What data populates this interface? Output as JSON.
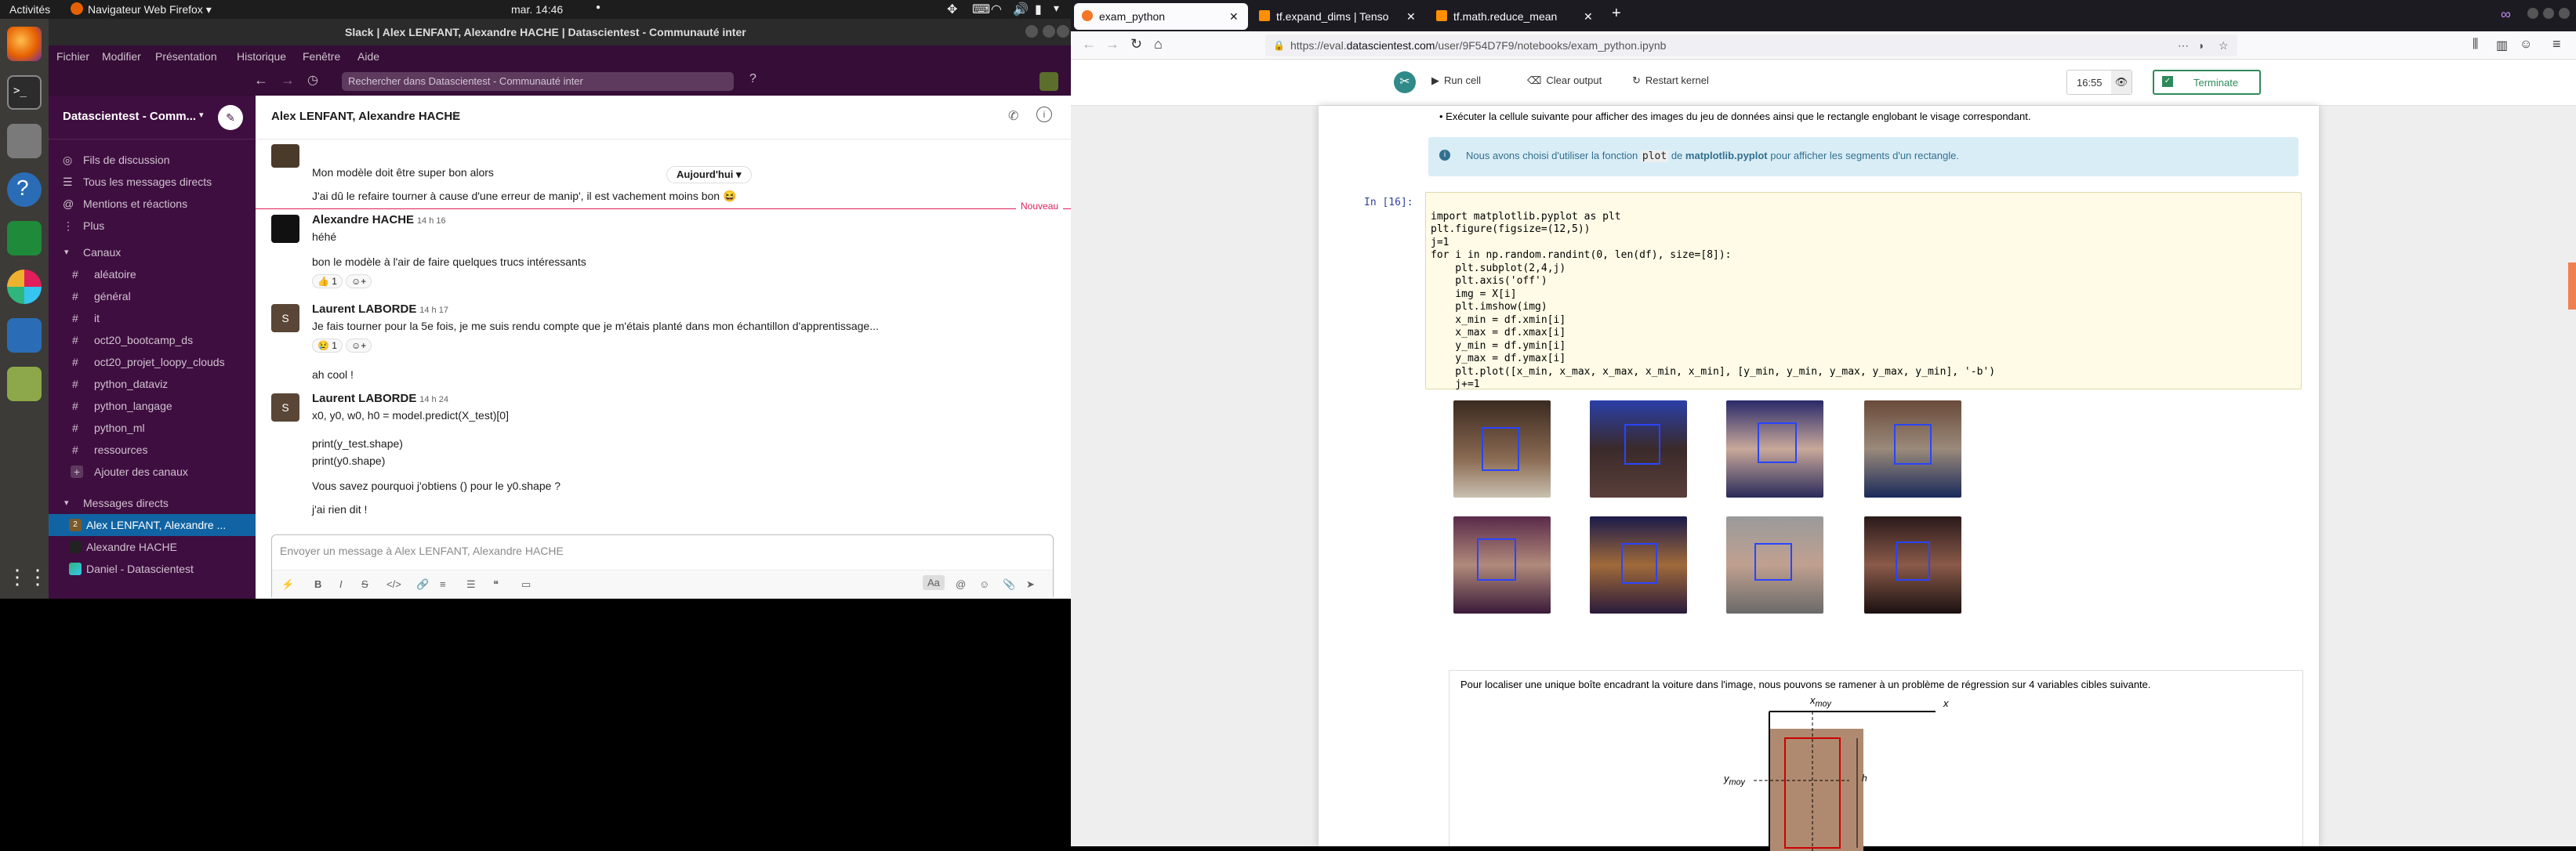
{
  "topbar": {
    "activities": "Activités",
    "app": "Navigateur Web Firefox",
    "clock": "mar. 14:46"
  },
  "slack": {
    "window_title": "Slack | Alex LENFANT, Alexandre HACHE | Datascientest - Communauté inter",
    "menu": [
      "Fichier",
      "Modifier",
      "Présentation",
      "Historique",
      "Fenêtre",
      "Aide"
    ],
    "search_placeholder": "Rechercher dans Datascientest - Communauté inter",
    "workspace": "Datascientest - Comm...",
    "nav": [
      "Fils de discussion",
      "Tous les messages directs",
      "Mentions et réactions",
      "Plus"
    ],
    "channels_header": "Canaux",
    "channels": [
      "aléatoire",
      "général",
      "it",
      "oct20_bootcamp_ds",
      "oct20_projet_loopy_clouds",
      "python_dataviz",
      "python_langage",
      "python_ml",
      "ressources"
    ],
    "add_channels": "Ajouter des canaux",
    "dm_header": "Messages directs",
    "dms": [
      "Alex LENFANT, Alexandre ...",
      "Alexandre HACHE",
      "Daniel - Datascientest"
    ],
    "dm_badge": "2",
    "conversation_title": "Alex LENFANT, Alexandre HACHE",
    "date_pill": "Aujourd'hui",
    "new_label": "Nouveau",
    "messages": [
      {
        "author": "",
        "time": "",
        "lines": [
          "Mon modèle doit être super bon alors",
          "J'ai dû le refaire tourner à cause d'une erreur de manip', il est vachement moins bon"
        ]
      },
      {
        "author": "Alexandre HACHE",
        "time": "14 h 16",
        "lines": [
          "héhé",
          "bon le modèle à l'air de faire quelques trucs intéressants"
        ],
        "reaction": "👍 1"
      },
      {
        "author": "Laurent LABORDE",
        "time": "14 h 17",
        "lines": [
          "Je fais tourner pour la 5e fois, je me suis rendu compte que je m'étais planté dans mon échantillon d'apprentissage...",
          "ah cool !"
        ],
        "reaction": "😢 1"
      },
      {
        "author": "Laurent LABORDE",
        "time": "14 h 24",
        "lines": [
          "x0, y0, w0, h0 = model.predict(X_test)[0]",
          "print(y_test.shape)",
          "print(y0.shape)",
          "Vous savez pourquoi j'obtiens () pour le y0.shape ?",
          "j'ai rien dit !"
        ]
      }
    ],
    "composer_placeholder": "Envoyer un message à Alex LENFANT, Alexandre HACHE",
    "composer_aa": "Aa"
  },
  "firefox": {
    "tabs": [
      "exam_python",
      "tf.expand_dims | Tenso",
      "tf.math.reduce_mean"
    ],
    "url_prefix": "https://eval.",
    "url_domain": "datascientest.com",
    "url_suffix": "/user/9F54D7F9/notebooks/exam_python.ipynb",
    "toolbar": {
      "run": "Run cell",
      "clear": "Clear output",
      "restart": "Restart kernel",
      "timer": "16:55",
      "terminate": "Terminate"
    },
    "bullet": "Exécuter la cellule suivante pour afficher des images du jeu de données ainsi que le rectangle englobant le visage correspondant.",
    "info_prefix": "Nous avons choisi d'utiliser la fonction",
    "info_code": "plot",
    "info_mid": "de",
    "info_lib": "matplotlib.pyplot",
    "info_suffix": "pour afficher les segments d'un rectangle.",
    "prompt": "In [16]:",
    "code_lines": [
      "import matplotlib.pyplot as plt",
      "plt.figure(figsize=(12,5))",
      "j=1",
      "for i in np.random.randint(0, len(df), size=[8]):",
      "    plt.subplot(2,4,j)",
      "    plt.axis('off')",
      "    img = X[i]",
      "    plt.imshow(img)",
      "    x_min = df.xmin[i]",
      "    x_max = df.xmax[i]",
      "    y_min = df.ymin[i]",
      "    y_max = df.ymax[i]",
      "    plt.plot([x_min, x_max, x_max, x_min, x_min], [y_min, y_min, y_max, y_max, y_min], '-b')",
      "    j+=1"
    ],
    "regression_text": "Pour localiser une unique boîte encadrant la voiture dans l'image, nous pouvons se ramener à un problème de régression sur 4 variables cibles suivante.",
    "diagram_labels": {
      "xmoy": "x",
      "xmoy_sub": "moy",
      "x": "x",
      "ymoy": "y",
      "ymoy_sub": "moy",
      "h": "h"
    }
  }
}
